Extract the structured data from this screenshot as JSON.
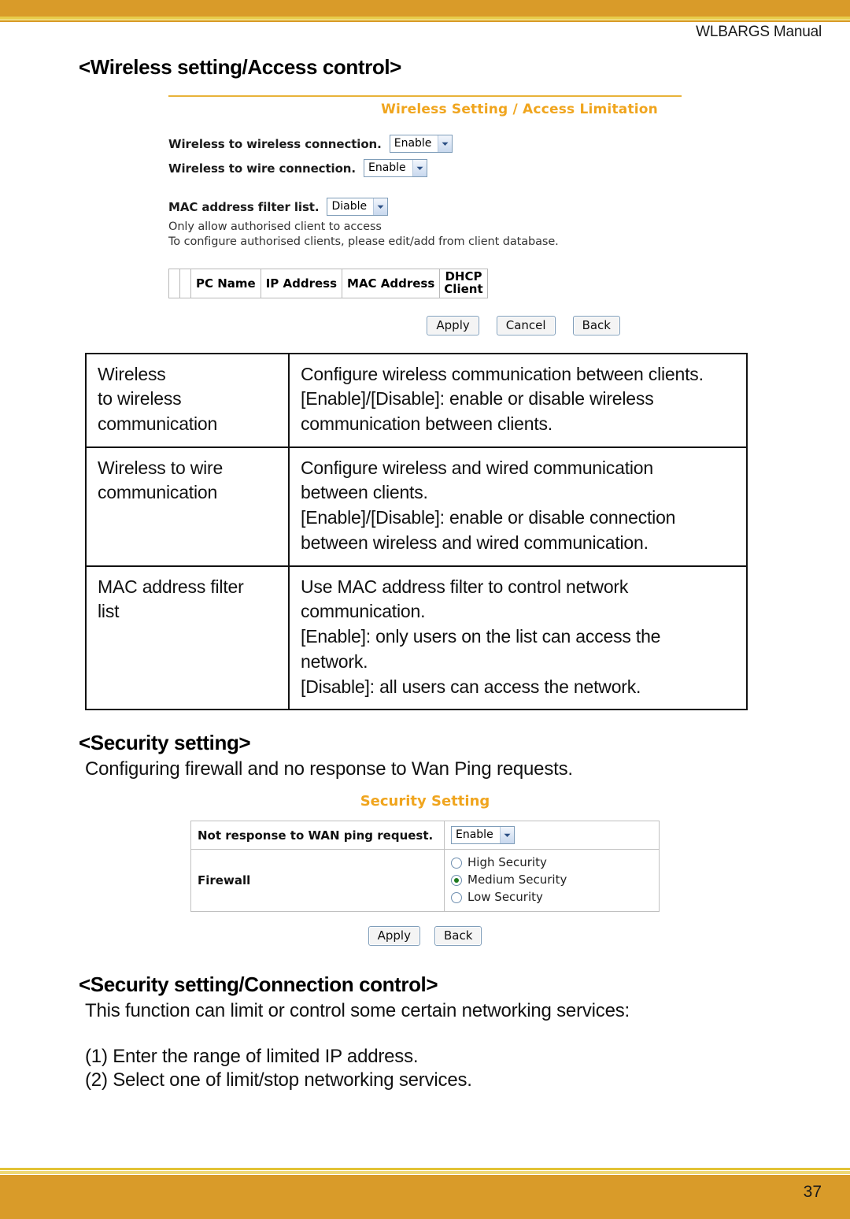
{
  "page": {
    "running_head": "WLBARGS Manual",
    "number": "37",
    "band_color": "#d99b29",
    "accent_color": "#f0a51e"
  },
  "sections": [
    {
      "heading": "<Wireless setting/Access control>"
    },
    {
      "heading": "<Security setting>",
      "paragraph": "Configuring firewall and no response to Wan Ping requests."
    },
    {
      "heading": "<Security setting/Connection control>",
      "paragraph": "This function can limit or control some certain networking services:",
      "steps": [
        "(1) Enter the range of limited IP address.",
        "(2) Select one of limit/stop networking services."
      ]
    }
  ],
  "wireless_screenshot": {
    "title": "Wireless Setting / Access Limitation",
    "fields": [
      {
        "label": "Wireless to wireless connection.",
        "value": "Enable"
      },
      {
        "label": "Wireless to wire connection.",
        "value": "Enable"
      },
      {
        "label": "MAC address filter list.",
        "value": "Diable"
      }
    ],
    "notes": [
      "Only allow authorised client to access",
      "To configure authorised clients, please edit/add from client database."
    ],
    "client_table": {
      "headers": [
        "PC Name",
        "IP Address",
        "MAC Address",
        "DHCP Client"
      ],
      "dhcp_header_line1": "DHCP",
      "dhcp_header_line2": "Client"
    },
    "buttons": [
      "Apply",
      "Cancel",
      "Back"
    ]
  },
  "description_table": {
    "rows": [
      {
        "term": "Wireless\nto wireless\ncommunication",
        "term_lines": [
          "Wireless",
          "to wireless",
          "communication"
        ],
        "definition_lines": [
          "Configure wireless communication between clients.",
          "[Enable]/[Disable]: enable or disable wireless",
          "communication between clients."
        ]
      },
      {
        "term_lines": [
          "Wireless to wire",
          "communication"
        ],
        "definition_lines": [
          "Configure wireless and wired communication",
          "between clients.",
          "[Enable]/[Disable]: enable or disable connection",
          "between wireless and wired communication."
        ]
      },
      {
        "term_lines": [
          "MAC address filter",
          "list"
        ],
        "definition_lines": [
          "Use MAC address filter to control network",
          "communication.",
          "[Enable]: only users on the list can access the",
          "network.",
          "[Disable]: all users can access the network."
        ]
      }
    ]
  },
  "security_screenshot": {
    "title": "Security Setting",
    "ping_label": "Not response to WAN ping request.",
    "ping_value": "Enable",
    "firewall_label": "Firewall",
    "firewall_options": [
      {
        "label": "High Security",
        "selected": false
      },
      {
        "label": "Medium Security",
        "selected": true
      },
      {
        "label": "Low Security",
        "selected": false
      }
    ],
    "buttons": [
      "Apply",
      "Back"
    ]
  }
}
